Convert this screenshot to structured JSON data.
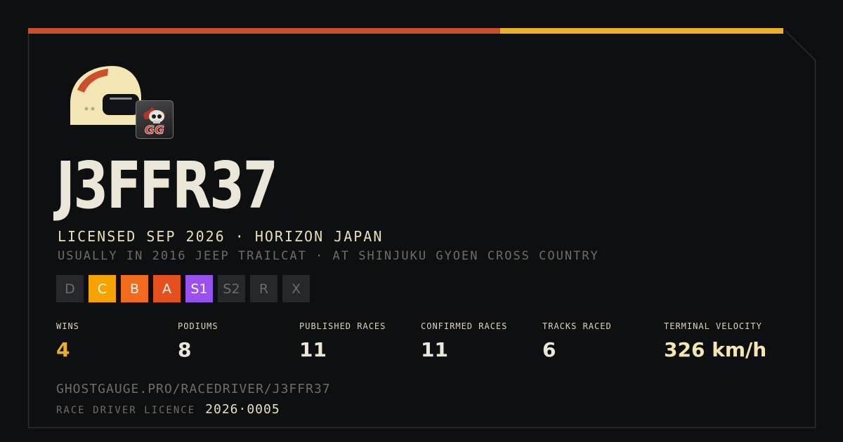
{
  "colors": {
    "background": "#0e0f11",
    "border": "#2c2d30",
    "accent_orange": "#c9502a",
    "accent_yellow": "#e8b02c",
    "helmet": "#f3e6b4",
    "wins_value": "#e8b02c",
    "velocity_value": "#f3e6b4"
  },
  "driver": {
    "name": "J3FFR37",
    "licensed": "LICENSED SEP 2026 · HORIZON JAPAN",
    "usually": "USUALLY IN 2016 JEEP TRAILCAT · AT SHINJUKU GYOEN CROSS COUNTRY",
    "avatar_icon": "helmet-icon",
    "badge_icon": "flaming-skull-gg-icon",
    "badge_text": "GG"
  },
  "tiers": [
    {
      "label": "D",
      "active": false,
      "bg": "#26272a",
      "fg": "#6d6c66"
    },
    {
      "label": "C",
      "active": true,
      "bg": "#f5a300",
      "fg": "#ffffff"
    },
    {
      "label": "B",
      "active": true,
      "bg": "#f26a1b",
      "fg": "#ffffff"
    },
    {
      "label": "A",
      "active": true,
      "bg": "#e4511c",
      "fg": "#ffffff"
    },
    {
      "label": "S1",
      "active": true,
      "bg": "#9a4ff0",
      "fg": "#ffffff"
    },
    {
      "label": "S2",
      "active": false,
      "bg": "#26272a",
      "fg": "#6d6c66"
    },
    {
      "label": "R",
      "active": false,
      "bg": "#26272a",
      "fg": "#6d6c66"
    },
    {
      "label": "X",
      "active": false,
      "bg": "#26272a",
      "fg": "#6d6c66"
    }
  ],
  "stats": [
    {
      "label": "WINS",
      "value": "4",
      "color": "#e8b02c"
    },
    {
      "label": "PODIUMS",
      "value": "8",
      "color": "#ece6d8"
    },
    {
      "label": "PUBLISHED RACES",
      "value": "11",
      "color": "#ece6d8"
    },
    {
      "label": "CONFIRMED RACES",
      "value": "11",
      "color": "#ece6d8"
    },
    {
      "label": "TRACKS RACED",
      "value": "6",
      "color": "#ece6d8"
    },
    {
      "label": "TERMINAL VELOCITY",
      "value": "326 km/h",
      "color": "#f3e6b4"
    }
  ],
  "footer": {
    "url": "GHOSTGAUGE.PRO/RACEDRIVER/J3FFR37",
    "licence_label": "RACE DRIVER LICENCE",
    "licence_number": "2026·0005"
  }
}
